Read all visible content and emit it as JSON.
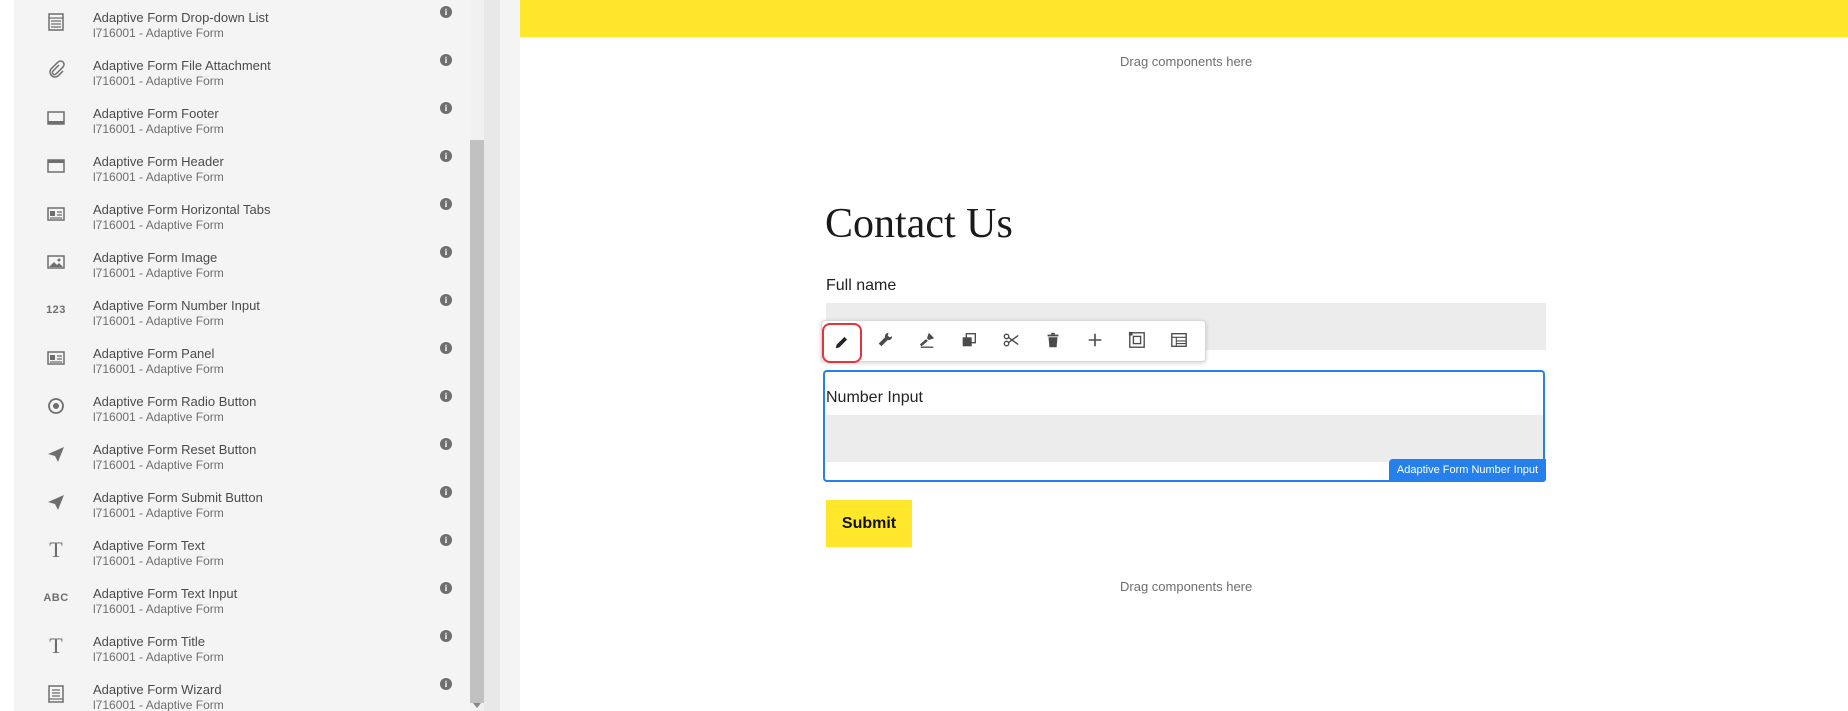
{
  "components": [
    {
      "name": "Adaptive Form Drop-down List",
      "group": "l716001 - Adaptive Form",
      "icon": "dropdown-list-icon"
    },
    {
      "name": "Adaptive Form File Attachment",
      "group": "l716001 - Adaptive Form",
      "icon": "paperclip-icon"
    },
    {
      "name": "Adaptive Form Footer",
      "group": "l716001 - Adaptive Form",
      "icon": "footer-icon"
    },
    {
      "name": "Adaptive Form Header",
      "group": "l716001 - Adaptive Form",
      "icon": "header-icon"
    },
    {
      "name": "Adaptive Form Horizontal Tabs",
      "group": "l716001 - Adaptive Form",
      "icon": "tabs-icon"
    },
    {
      "name": "Adaptive Form Image",
      "group": "l716001 - Adaptive Form",
      "icon": "image-icon"
    },
    {
      "name": "Adaptive Form Number Input",
      "group": "l716001 - Adaptive Form",
      "icon": "number-icon",
      "icon_text": "123"
    },
    {
      "name": "Adaptive Form Panel",
      "group": "l716001 - Adaptive Form",
      "icon": "panel-icon"
    },
    {
      "name": "Adaptive Form Radio Button",
      "group": "l716001 - Adaptive Form",
      "icon": "radio-icon"
    },
    {
      "name": "Adaptive Form Reset Button",
      "group": "l716001 - Adaptive Form",
      "icon": "send-icon"
    },
    {
      "name": "Adaptive Form Submit Button",
      "group": "l716001 - Adaptive Form",
      "icon": "send-icon"
    },
    {
      "name": "Adaptive Form Text",
      "group": "l716001 - Adaptive Form",
      "icon": "text-icon",
      "icon_text": "T"
    },
    {
      "name": "Adaptive Form Text Input",
      "group": "l716001 - Adaptive Form",
      "icon": "text-input-icon",
      "icon_text": "ABC"
    },
    {
      "name": "Adaptive Form Title",
      "group": "l716001 - Adaptive Form",
      "icon": "title-icon",
      "icon_text": "T"
    },
    {
      "name": "Adaptive Form Wizard",
      "group": "l716001 - Adaptive Form",
      "icon": "wizard-icon"
    }
  ],
  "info_glyph": "i",
  "canvas": {
    "drag_top": "Drag components here",
    "title": "Contact Us",
    "full_name_label": "Full name",
    "number_label": "Number Input",
    "selected_badge": "Adaptive Form Number Input",
    "submit_label": "Submit",
    "drag_bottom": "Drag components here"
  },
  "toolbar": [
    {
      "id": "edit",
      "icon": "pencil-icon",
      "highlighted": true
    },
    {
      "id": "configure",
      "icon": "wrench-icon"
    },
    {
      "id": "style",
      "icon": "paintbrush-icon"
    },
    {
      "id": "copy",
      "icon": "copy-icon"
    },
    {
      "id": "cut",
      "icon": "scissors-icon"
    },
    {
      "id": "delete",
      "icon": "trash-icon"
    },
    {
      "id": "insert",
      "icon": "plus-icon"
    },
    {
      "id": "parent",
      "icon": "select-parent-icon"
    },
    {
      "id": "layout",
      "icon": "layout-icon"
    }
  ],
  "colors": {
    "accent": "#2680eb",
    "brand_yellow": "#ffe82b",
    "highlight_red": "#e3343b"
  }
}
